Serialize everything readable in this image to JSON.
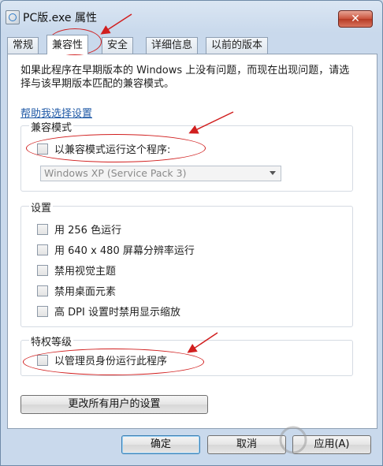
{
  "window": {
    "title": "PC版.exe 属性",
    "close_symbol": "✕"
  },
  "tabs": [
    "常规",
    "兼容性",
    "安全",
    "详细信息",
    "以前的版本"
  ],
  "panel": {
    "intro": "如果此程序在早期版本的 Windows 上没有问题，而现在出现问题，请选择与该早期版本匹配的兼容模式。",
    "help_link": "帮助我选择设置"
  },
  "compat_group": {
    "title": "兼容模式",
    "checkbox_label": "以兼容模式运行这个程序:",
    "dropdown_value": "Windows XP (Service Pack 3)"
  },
  "settings_group": {
    "title": "设置",
    "items": [
      "用 256 色运行",
      "用 640 x 480 屏幕分辨率运行",
      "禁用视觉主题",
      "禁用桌面元素",
      "高 DPI 设置时禁用显示缩放"
    ]
  },
  "privilege_group": {
    "title": "特权等级",
    "checkbox_label": "以管理员身份运行此程序"
  },
  "all_users_button": "更改所有用户的设置",
  "buttons": {
    "ok": "确定",
    "cancel": "取消",
    "apply": "应用(A)"
  },
  "annotation_color": "#d11f1f"
}
